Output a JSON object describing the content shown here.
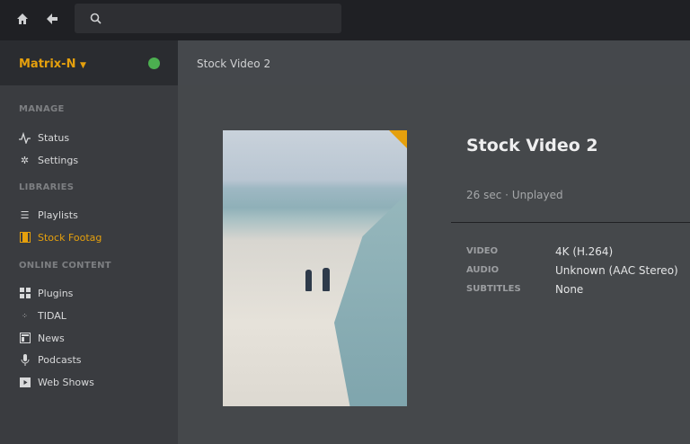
{
  "topbar": {
    "search_placeholder": ""
  },
  "server": {
    "name": "Matrix-N",
    "accent": "#e5a00d"
  },
  "sidebar": {
    "sections": [
      "MANAGE",
      "LIBRARIES",
      "ONLINE CONTENT"
    ],
    "items": [
      {
        "label": "Status",
        "icon": "activity-icon"
      },
      {
        "label": "Settings",
        "icon": "gear-icon"
      },
      {
        "label": "Playlists",
        "icon": "list-icon"
      },
      {
        "label": "Stock Footag",
        "icon": "film-icon",
        "active": true
      },
      {
        "label": "Plugins",
        "icon": "grid-icon"
      },
      {
        "label": "TIDAL",
        "icon": "tidal-icon"
      },
      {
        "label": "News",
        "icon": "news-icon"
      },
      {
        "label": "Podcasts",
        "icon": "microphone-icon"
      },
      {
        "label": "Web Shows",
        "icon": "play-icon"
      }
    ]
  },
  "breadcrumb": "Stock Video 2",
  "detail": {
    "title": "Stock Video 2",
    "duration": "26 sec",
    "separator": "·",
    "status": "Unplayed",
    "specs": [
      {
        "label": "VIDEO",
        "value": "4K (H.264)"
      },
      {
        "label": "AUDIO",
        "value": "Unknown (AAC Stereo)"
      },
      {
        "label": "SUBTITLES",
        "value": "None"
      }
    ]
  }
}
